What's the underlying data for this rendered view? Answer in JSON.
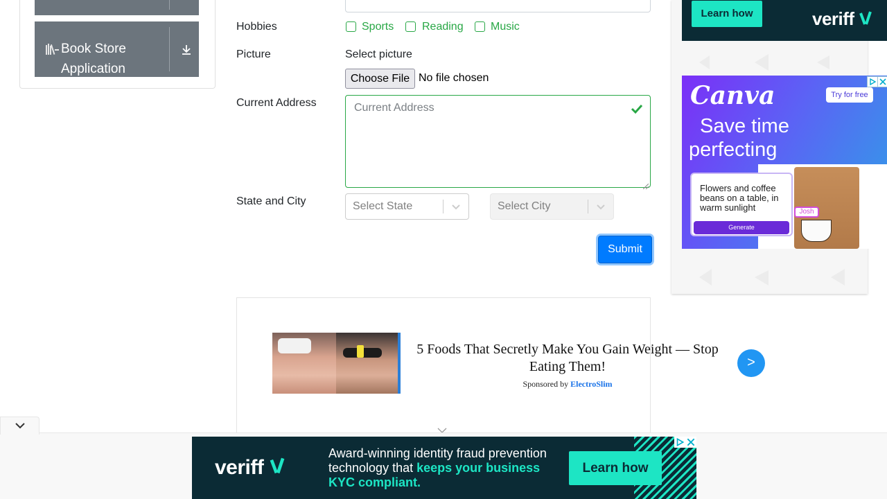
{
  "sidebar": {
    "items": [
      {
        "label": ""
      },
      {
        "label": "Book Store Application"
      }
    ]
  },
  "form": {
    "hobbies_label": "Hobbies",
    "hobbies": [
      "Sports",
      "Reading",
      "Music"
    ],
    "picture_label": "Picture",
    "select_picture_label": "Select picture",
    "file_button": "Choose File",
    "file_status": "No file chosen",
    "address_label": "Current Address",
    "address_placeholder": "Current Address",
    "state_city_label": "State and City",
    "state_placeholder": "Select State",
    "city_placeholder": "Select City",
    "submit_label": "Submit"
  },
  "sponsored": {
    "title": "5 Foods That Secretly Make You Gain Weight — Stop Eating Them!",
    "by_prefix": "Sponsored by",
    "by_brand": "ElectroSlim",
    "arrow": ">"
  },
  "ads": {
    "veriff_top": {
      "button": "Learn how",
      "logo": "veriff"
    },
    "canva": {
      "logo": "Canva",
      "try": "Try for free",
      "headline_1": "Save time",
      "headline_2": "perfecting",
      "prompt": "Flowers and coffee beans on a table, in warm sunlight",
      "generate": "Generate",
      "user": "Josh"
    },
    "veriff_bottom": {
      "logo": "veriff",
      "text_plain": "Award-winning identity fraud prevention technology that",
      "text_highlight": "keeps your business KYC compliant.",
      "button": "Learn how"
    }
  },
  "colors": {
    "accent": "#007bff",
    "success": "#28a745",
    "veriff_bg": "#0b2b35",
    "veriff_teal": "#1de5c4"
  }
}
